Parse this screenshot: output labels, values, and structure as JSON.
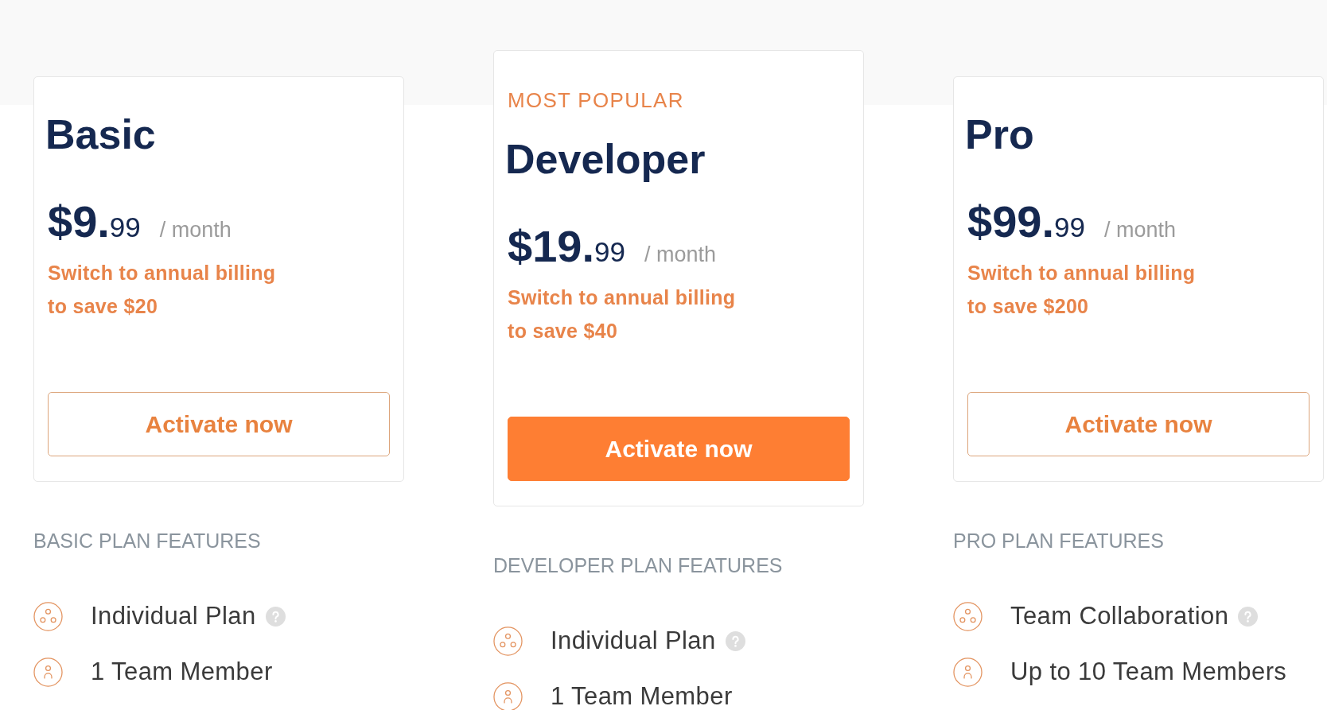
{
  "plans": [
    {
      "name": "Basic",
      "featured": false,
      "price": {
        "whole": "$9.",
        "cents": "99"
      },
      "period": "/ month",
      "savings": [
        "Switch to annual billing",
        "to save $20"
      ],
      "button": "Activate now",
      "features_title": "BASIC PLAN FEATURES",
      "features": [
        {
          "kind": "plan",
          "label": "Individual Plan",
          "tooltip": true
        },
        {
          "kind": "members",
          "label": "1 Team Member",
          "tooltip": false
        }
      ]
    },
    {
      "badge": "MOST POPULAR",
      "name": "Developer",
      "featured": true,
      "price": {
        "whole": "$19.",
        "cents": "99"
      },
      "period": "/ month",
      "savings": [
        "Switch to annual billing",
        "to save $40"
      ],
      "button": "Activate now",
      "features_title": "DEVELOPER PLAN FEATURES",
      "features": [
        {
          "kind": "plan",
          "label": "Individual Plan",
          "tooltip": true
        },
        {
          "kind": "members",
          "label": "1 Team Member",
          "tooltip": false
        }
      ]
    },
    {
      "name": "Pro",
      "featured": false,
      "price": {
        "whole": "$99.",
        "cents": "99"
      },
      "period": "/ month",
      "savings": [
        "Switch to annual billing",
        "to save $200"
      ],
      "button": "Activate now",
      "features_title": "PRO PLAN FEATURES",
      "features": [
        {
          "kind": "plan",
          "label": "Team Collaboration",
          "tooltip": true
        },
        {
          "kind": "members",
          "label": "Up to 10 Team Members",
          "tooltip": false
        }
      ]
    }
  ]
}
